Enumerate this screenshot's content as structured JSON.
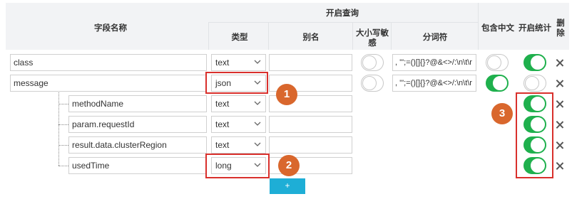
{
  "header": {
    "field_name": "字段名称",
    "enable_query": "开启查询",
    "type": "类型",
    "alias": "别名",
    "case_line1": "大小写敏",
    "case_line2": "感",
    "tokenizer": "分词符",
    "include_chinese": "包含中文",
    "enable_stats": "开启统计",
    "delete_line1": "删",
    "delete_line2": "除"
  },
  "rows": [
    {
      "name": "class",
      "type": "text",
      "tokenizer": ", '\";=()[]{}?@&<>/:\\n\\t\\r",
      "case_sensitive": false,
      "include_chinese": false,
      "enable_stats": true
    },
    {
      "name": "message",
      "type": "json",
      "tokenizer": ", '\";=()[]{}?@&<>/:\\n\\t\\r",
      "case_sensitive": false,
      "include_chinese": true,
      "enable_stats": false
    },
    {
      "name": "methodName",
      "type": "text",
      "enable_stats": true
    },
    {
      "name": "param.requestId",
      "type": "text",
      "enable_stats": true
    },
    {
      "name": "result.data.clusterRegion",
      "type": "text",
      "enable_stats": true
    },
    {
      "name": "usedTime",
      "type": "long",
      "enable_stats": true
    }
  ],
  "add_button": "+",
  "annotations": [
    "1",
    "2",
    "3"
  ],
  "colors": {
    "toggle_on": "#1fb04d",
    "highlight": "#d9302c",
    "badge": "#d9672d",
    "add_button": "#1eaed6"
  },
  "icons": {
    "dropdown": "chevron-down-icon",
    "delete": "close-icon"
  }
}
